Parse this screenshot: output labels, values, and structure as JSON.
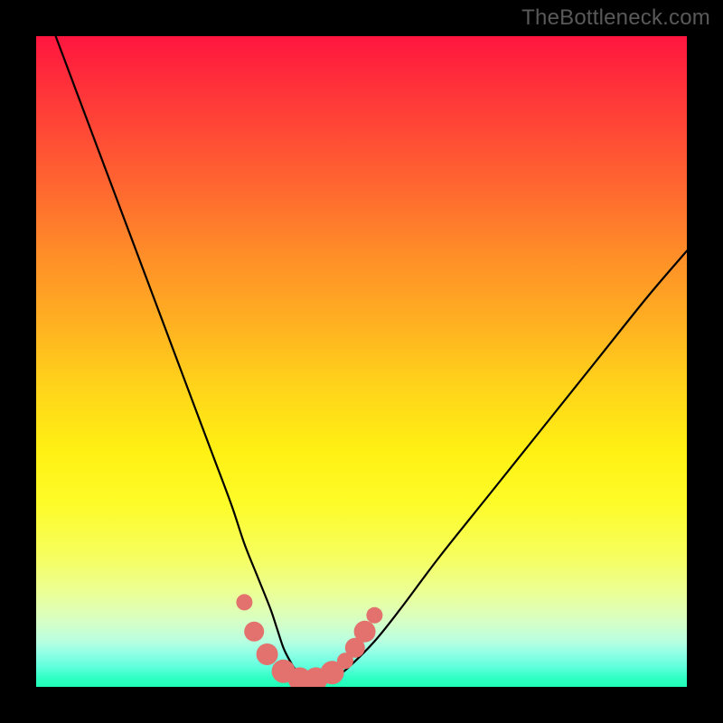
{
  "watermark": "TheBottleneck.com",
  "chart_data": {
    "type": "line",
    "title": "",
    "xlabel": "",
    "ylabel": "",
    "xlim": [
      0,
      100
    ],
    "ylim": [
      0,
      100
    ],
    "grid": false,
    "series": [
      {
        "name": "bottleneck-curve",
        "color": "#000000",
        "x": [
          3,
          6,
          9,
          12,
          15,
          18,
          21,
          24,
          27,
          30,
          32,
          34,
          36,
          37,
          38,
          39,
          40,
          42,
          44,
          46,
          48,
          52,
          56,
          62,
          70,
          78,
          86,
          94,
          100
        ],
        "y": [
          100,
          92,
          84,
          76,
          68,
          60,
          52,
          44,
          36,
          28,
          22,
          17,
          12,
          9,
          6,
          4,
          2.5,
          1.2,
          0.7,
          1.5,
          3,
          7,
          12,
          20,
          30,
          40,
          50,
          60,
          67
        ]
      }
    ],
    "markers": {
      "name": "highlighted-points",
      "color": "#e3716d",
      "points": [
        {
          "x": 32.0,
          "y": 13.0,
          "r": 9
        },
        {
          "x": 33.5,
          "y": 8.5,
          "r": 11
        },
        {
          "x": 35.5,
          "y": 5.0,
          "r": 12
        },
        {
          "x": 38.0,
          "y": 2.4,
          "r": 13
        },
        {
          "x": 40.5,
          "y": 1.2,
          "r": 13
        },
        {
          "x": 43.0,
          "y": 1.2,
          "r": 13
        },
        {
          "x": 45.5,
          "y": 2.2,
          "r": 13
        },
        {
          "x": 47.5,
          "y": 4.0,
          "r": 9
        },
        {
          "x": 49.0,
          "y": 6.0,
          "r": 11
        },
        {
          "x": 50.5,
          "y": 8.5,
          "r": 12
        },
        {
          "x": 52.0,
          "y": 11.0,
          "r": 9
        }
      ]
    },
    "gradient_stops": [
      {
        "pos": 0.0,
        "color": "#ff163f"
      },
      {
        "pos": 0.5,
        "color": "#ffd41a"
      },
      {
        "pos": 0.8,
        "color": "#f6fe5f"
      },
      {
        "pos": 1.0,
        "color": "#1effb6"
      }
    ]
  }
}
